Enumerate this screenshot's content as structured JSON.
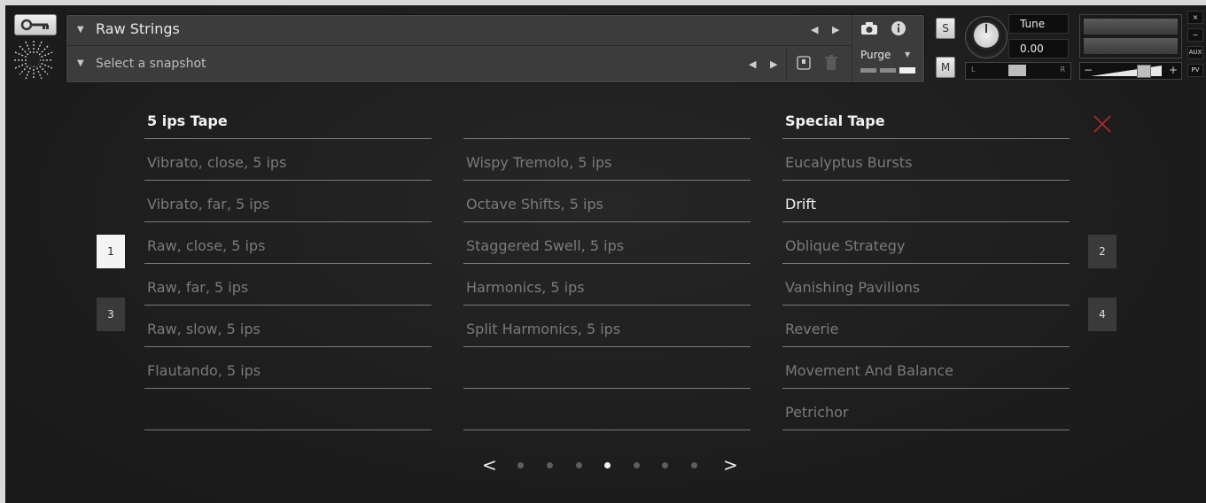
{
  "header": {
    "instrument_name": "Raw Strings",
    "snapshot_placeholder": "Select a snapshot",
    "purge_label": "Purge",
    "solo_label": "S",
    "mute_label": "M",
    "tune_label": "Tune",
    "tune_value": "0.00",
    "pan_left": "L",
    "pan_right": "R",
    "vol_minus": "−",
    "vol_plus": "+",
    "side_buttons": [
      "×",
      "−",
      "AUX",
      "PV"
    ]
  },
  "columns": [
    {
      "heading": "5 ips Tape",
      "items": [
        "Vibrato, close, 5 ips",
        "Vibrato, far, 5 ips",
        "Raw, close, 5 ips",
        "Raw, far, 5 ips",
        "Raw, slow, 5 ips",
        "Flautando, 5 ips",
        ""
      ]
    },
    {
      "heading": "",
      "items": [
        "Wispy Tremolo, 5 ips",
        "Octave Shifts, 5 ips",
        "Staggered Swell, 5 ips",
        "Harmonics, 5 ips",
        "Split Harmonics, 5 ips",
        "",
        ""
      ]
    },
    {
      "heading": "Special Tape",
      "items": [
        "Eucalyptus Bursts",
        "Drift",
        "Oblique Strategy",
        "Vanishing Pavilions",
        "Reverie",
        "Movement And Balance",
        "Petrichor"
      ],
      "active_item": "Drift"
    }
  ],
  "slots": [
    {
      "label": "1",
      "selected": true
    },
    {
      "label": "2",
      "selected": false
    },
    {
      "label": "3",
      "selected": false
    },
    {
      "label": "4",
      "selected": false
    }
  ],
  "pager": {
    "total": 7,
    "current": 4,
    "prev": "<",
    "next": ">"
  },
  "colors": {
    "close_x": "#b02a2a",
    "active_text": "#f2f2f2",
    "inactive_text": "#7a7a7a"
  }
}
